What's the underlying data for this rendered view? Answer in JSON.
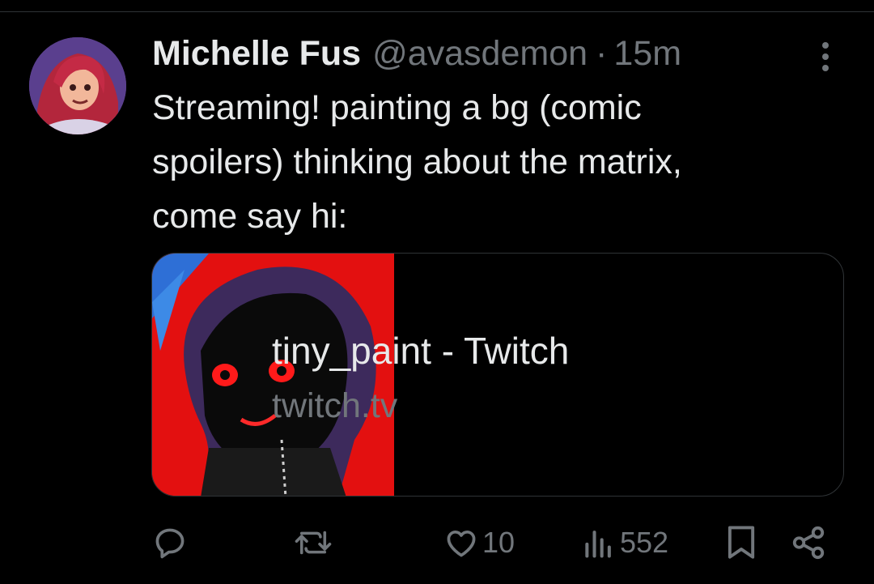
{
  "tweet": {
    "author_name": "Michelle Fus",
    "handle": "@avasdemon",
    "separator": "·",
    "time": "15m",
    "text": "Streaming! painting a bg (comic\nspoilers) thinking about the matrix,\ncome say hi:"
  },
  "card": {
    "title": "tiny_paint - Twitch",
    "domain": "twitch.tv"
  },
  "actions": {
    "likes": "10",
    "views": "552"
  },
  "icons": {
    "reply": "reply-icon",
    "repost": "repost-icon",
    "like": "heart-icon",
    "views": "analytics-icon",
    "bookmark": "bookmark-icon",
    "share": "share-icon",
    "more": "more-icon"
  },
  "colors": {
    "background": "#000000",
    "text_primary": "#e7e9ea",
    "text_secondary": "#71767b",
    "border": "#2f3336",
    "thumbnail_red": "#e31010"
  }
}
